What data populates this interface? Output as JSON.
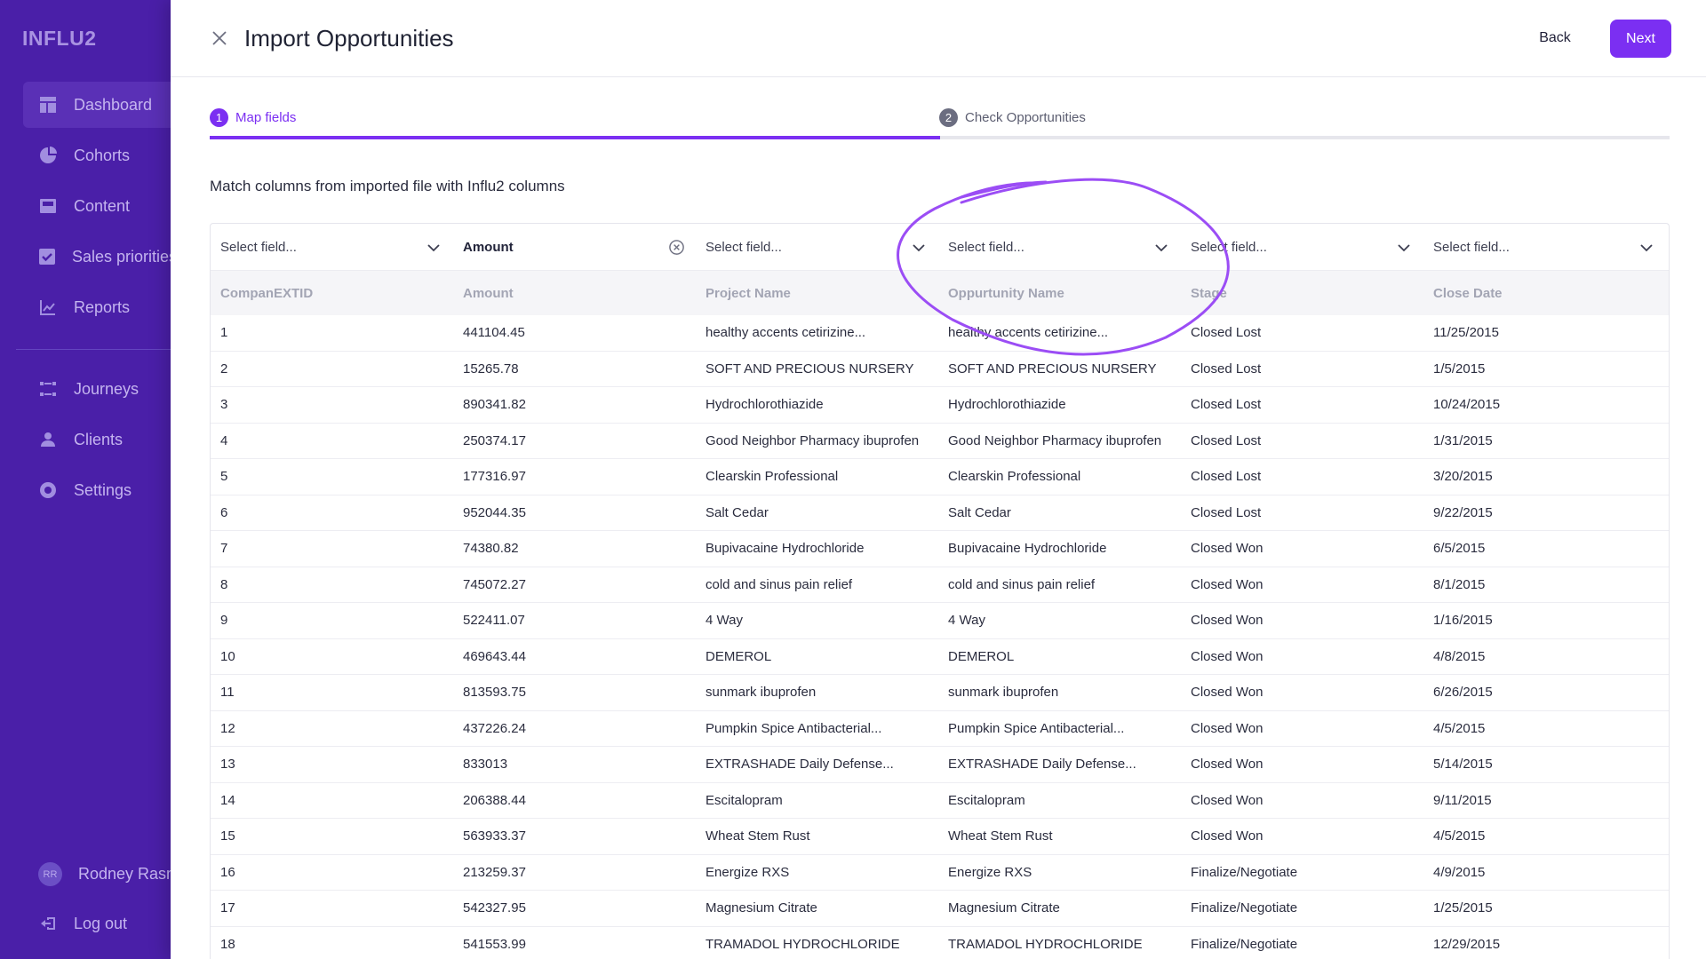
{
  "app": {
    "logo": "INFLU2"
  },
  "sidebar": {
    "items": [
      {
        "label": "Dashboard",
        "icon": "dashboard-icon",
        "active": true
      },
      {
        "label": "Cohorts",
        "icon": "pie-chart-icon"
      },
      {
        "label": "Content",
        "icon": "content-icon"
      },
      {
        "label": "Sales priorities",
        "icon": "checkbox-icon"
      },
      {
        "label": "Reports",
        "icon": "line-chart-icon"
      },
      {
        "label": "Journeys",
        "icon": "journeys-icon"
      },
      {
        "label": "Clients",
        "icon": "user-icon"
      },
      {
        "label": "Settings",
        "icon": "gear-icon"
      }
    ],
    "user": {
      "initials": "RR",
      "name": "Rodney Rasmussen"
    },
    "logout": "Log out"
  },
  "header": {
    "title": "Import Opportunities",
    "back_label": "Back",
    "next_label": "Next"
  },
  "steps": [
    {
      "num": "1",
      "label": "Map fields"
    },
    {
      "num": "2",
      "label": "Check Opportunities"
    }
  ],
  "subtitle": "Match columns from imported file with Influ2 columns",
  "mapping": [
    {
      "label": "Select field...",
      "mapped": false
    },
    {
      "label": "Amount",
      "mapped": true
    },
    {
      "label": "Select field...",
      "mapped": false
    },
    {
      "label": "Select field...",
      "mapped": false
    },
    {
      "label": "Select field...",
      "mapped": false
    },
    {
      "label": "Select field...",
      "mapped": false
    }
  ],
  "columns": [
    "CompanEXTID",
    "Amount",
    "Project Name",
    "Oppurtunity Name",
    "Stage",
    "Close Date"
  ],
  "rows": [
    [
      "1",
      "441104.45",
      "healthy accents cetirizine...",
      "healthy accents cetirizine...",
      "Closed Lost",
      "11/25/2015"
    ],
    [
      "2",
      "15265.78",
      "SOFT AND PRECIOUS NURSERY",
      "SOFT AND PRECIOUS NURSERY",
      "Closed Lost",
      "1/5/2015"
    ],
    [
      "3",
      "890341.82",
      "Hydrochlorothiazide",
      "Hydrochlorothiazide",
      "Closed Lost",
      "10/24/2015"
    ],
    [
      "4",
      "250374.17",
      "Good Neighbor Pharmacy ibuprofen",
      "Good Neighbor Pharmacy ibuprofen",
      "Closed Lost",
      "1/31/2015"
    ],
    [
      "5",
      "177316.97",
      "Clearskin Professional",
      "Clearskin Professional",
      "Closed Lost",
      "3/20/2015"
    ],
    [
      "6",
      "952044.35",
      "Salt Cedar",
      "Salt Cedar",
      "Closed Lost",
      "9/22/2015"
    ],
    [
      "7",
      "74380.82",
      "Bupivacaine Hydrochloride",
      "Bupivacaine Hydrochloride",
      "Closed Won",
      "6/5/2015"
    ],
    [
      "8",
      "745072.27",
      "cold and sinus pain relief",
      "cold and sinus pain relief",
      "Closed Won",
      "8/1/2015"
    ],
    [
      "9",
      "522411.07",
      "4 Way",
      "4 Way",
      "Closed Won",
      "1/16/2015"
    ],
    [
      "10",
      "469643.44",
      "DEMEROL",
      "DEMEROL",
      "Closed Won",
      "4/8/2015"
    ],
    [
      "11",
      "813593.75",
      "sunmark ibuprofen",
      "sunmark ibuprofen",
      "Closed Won",
      "6/26/2015"
    ],
    [
      "12",
      "437226.24",
      "Pumpkin Spice Antibacterial...",
      "Pumpkin Spice Antibacterial...",
      "Closed Won",
      "4/5/2015"
    ],
    [
      "13",
      "833013",
      "EXTRASHADE Daily Defense...",
      "EXTRASHADE Daily Defense...",
      "Closed Won",
      "5/14/2015"
    ],
    [
      "14",
      "206388.44",
      "Escitalopram",
      "Escitalopram",
      "Closed Won",
      "9/11/2015"
    ],
    [
      "15",
      "563933.37",
      "Wheat Stem Rust",
      "Wheat Stem Rust",
      "Closed Won",
      "4/5/2015"
    ],
    [
      "16",
      "213259.37",
      "Energize RXS",
      "Energize RXS",
      "Finalize/Negotiate",
      "4/9/2015"
    ],
    [
      "17",
      "542327.95",
      "Magnesium Citrate",
      "Magnesium Citrate",
      "Finalize/Negotiate",
      "1/25/2015"
    ],
    [
      "18",
      "541553.99",
      "TRAMADOL HYDROCHLORIDE",
      "TRAMADOL HYDROCHLORIDE",
      "Finalize/Negotiate",
      "12/29/2015"
    ]
  ],
  "colors": {
    "accent": "#7b2ff2",
    "sidebar": "#4a1fa8",
    "annotation": "#9b4df5"
  }
}
